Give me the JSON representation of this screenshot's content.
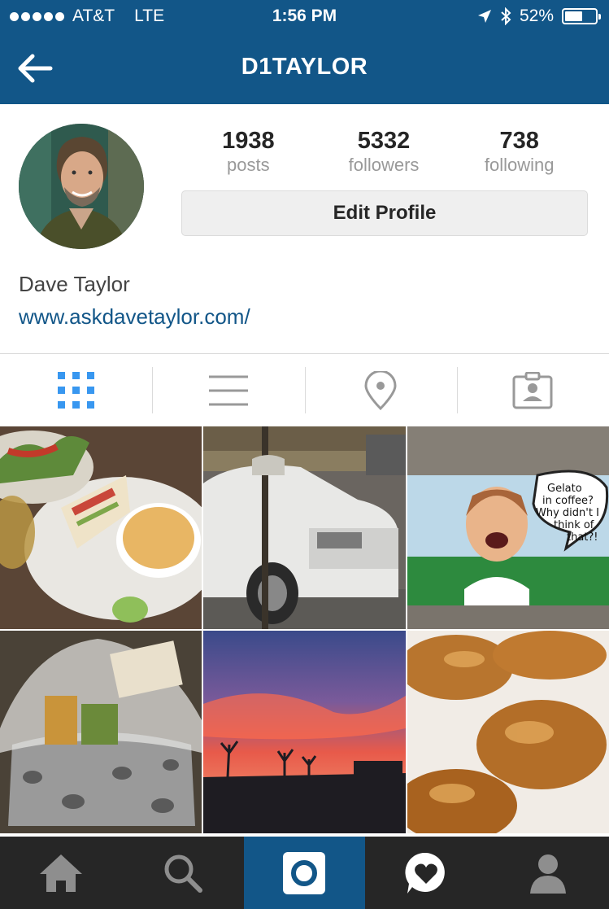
{
  "status": {
    "carrier": "AT&T",
    "network": "LTE",
    "time": "1:56 PM",
    "battery": "52%",
    "battery_level": 0.52
  },
  "header": {
    "title": "D1TAYLOR",
    "back_icon": "back-arrow-icon"
  },
  "profile": {
    "posts_count": "1938",
    "posts_label": "posts",
    "followers_count": "5332",
    "followers_label": "followers",
    "following_count": "738",
    "following_label": "following",
    "edit_label": "Edit Profile",
    "full_name": "Dave Taylor",
    "website": "www.askdavetaylor.com/"
  },
  "tabs": [
    "grid-icon",
    "list-icon",
    "location-pin-icon",
    "tagged-person-icon"
  ],
  "active_tab": "grid-icon",
  "photo3_caption": [
    "Gelato",
    "in coffee?",
    "Why didn't I",
    "think of",
    "that?!"
  ],
  "bottom_nav": [
    "home-icon",
    "search-icon",
    "camera-icon",
    "activity-heart-icon",
    "profile-icon"
  ],
  "active_nav": "camera-icon",
  "colors": {
    "brand": "#125688",
    "tab_active": "#3897f0",
    "nav_bg": "#262626"
  }
}
